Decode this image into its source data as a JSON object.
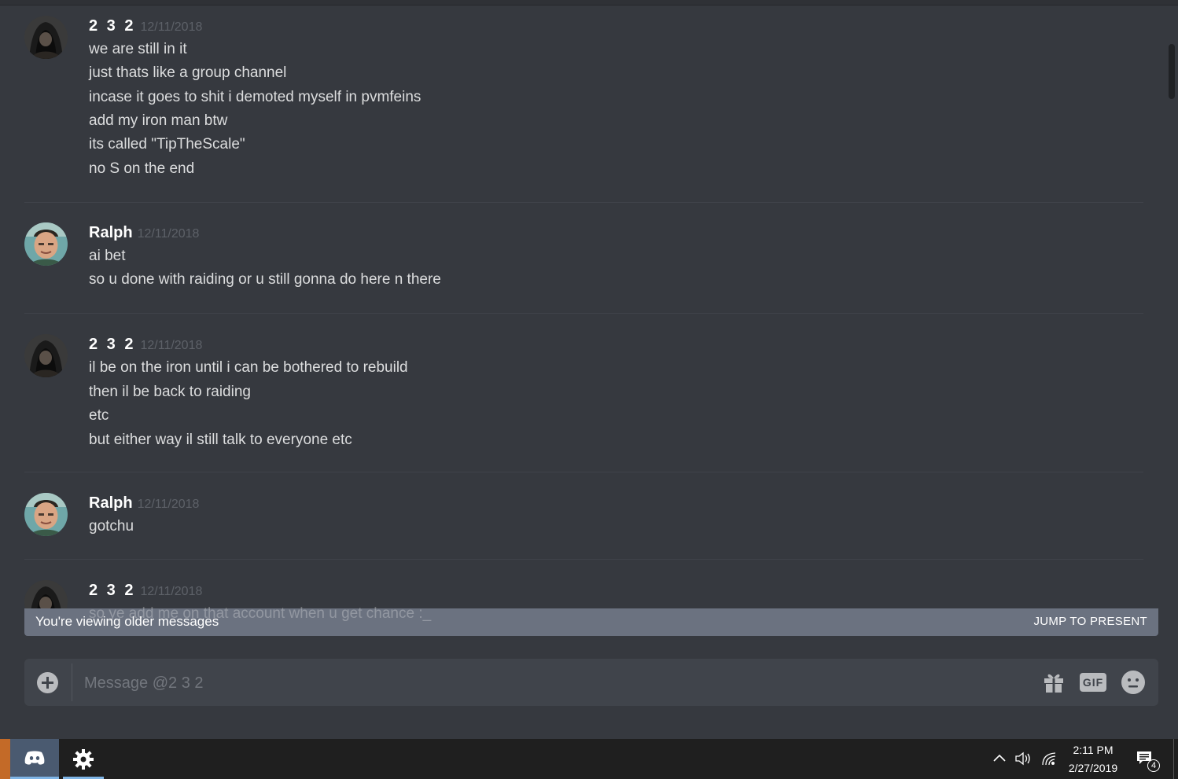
{
  "messages": [
    {
      "author": "2 3 2",
      "timestamp": "12/11/2018",
      "avatar": "hooded-figure",
      "lines": [
        "we are still in it",
        "just thats like a group channel",
        "incase it goes to shit i demoted myself in pvmfeins",
        "add my iron man btw",
        "its called \"TipTheScale\"",
        "no S on the end"
      ]
    },
    {
      "author": "Ralph",
      "timestamp": "12/11/2018",
      "avatar": "person-photo",
      "lines": [
        "ai bet",
        "so u done with raiding or u still gonna do here n there"
      ]
    },
    {
      "author": "2 3 2",
      "timestamp": "12/11/2018",
      "avatar": "hooded-figure",
      "lines": [
        "il be on the iron until i can be bothered to rebuild",
        "then il be back to raiding",
        "etc",
        "but either way il still talk to everyone etc"
      ]
    },
    {
      "author": "Ralph",
      "timestamp": "12/11/2018",
      "avatar": "person-photo",
      "lines": [
        "gotchu"
      ]
    },
    {
      "author": "2 3 2",
      "timestamp": "12/11/2018",
      "avatar": "hooded-figure",
      "lines": [
        "so ye add me on that account when u get chance :_"
      ]
    }
  ],
  "older_banner": {
    "text": "You're viewing older messages",
    "jump_label": "JUMP TO PRESENT"
  },
  "composer": {
    "placeholder": "Message @2 3 2",
    "icons": [
      "add-icon",
      "gift-icon",
      "gif-icon",
      "emoji-icon"
    ],
    "gif_label": "GIF"
  },
  "taskbar": {
    "apps": [
      "discord-icon",
      "settings-icon"
    ],
    "time": "2:11 PM",
    "date": "2/27/2019",
    "notification_count": "4"
  },
  "colors": {
    "background": "#36393f",
    "composer": "#40444b",
    "banner": "#6b7280",
    "timestamp": "#5d6168",
    "taskbar": "#1f1f1f"
  }
}
